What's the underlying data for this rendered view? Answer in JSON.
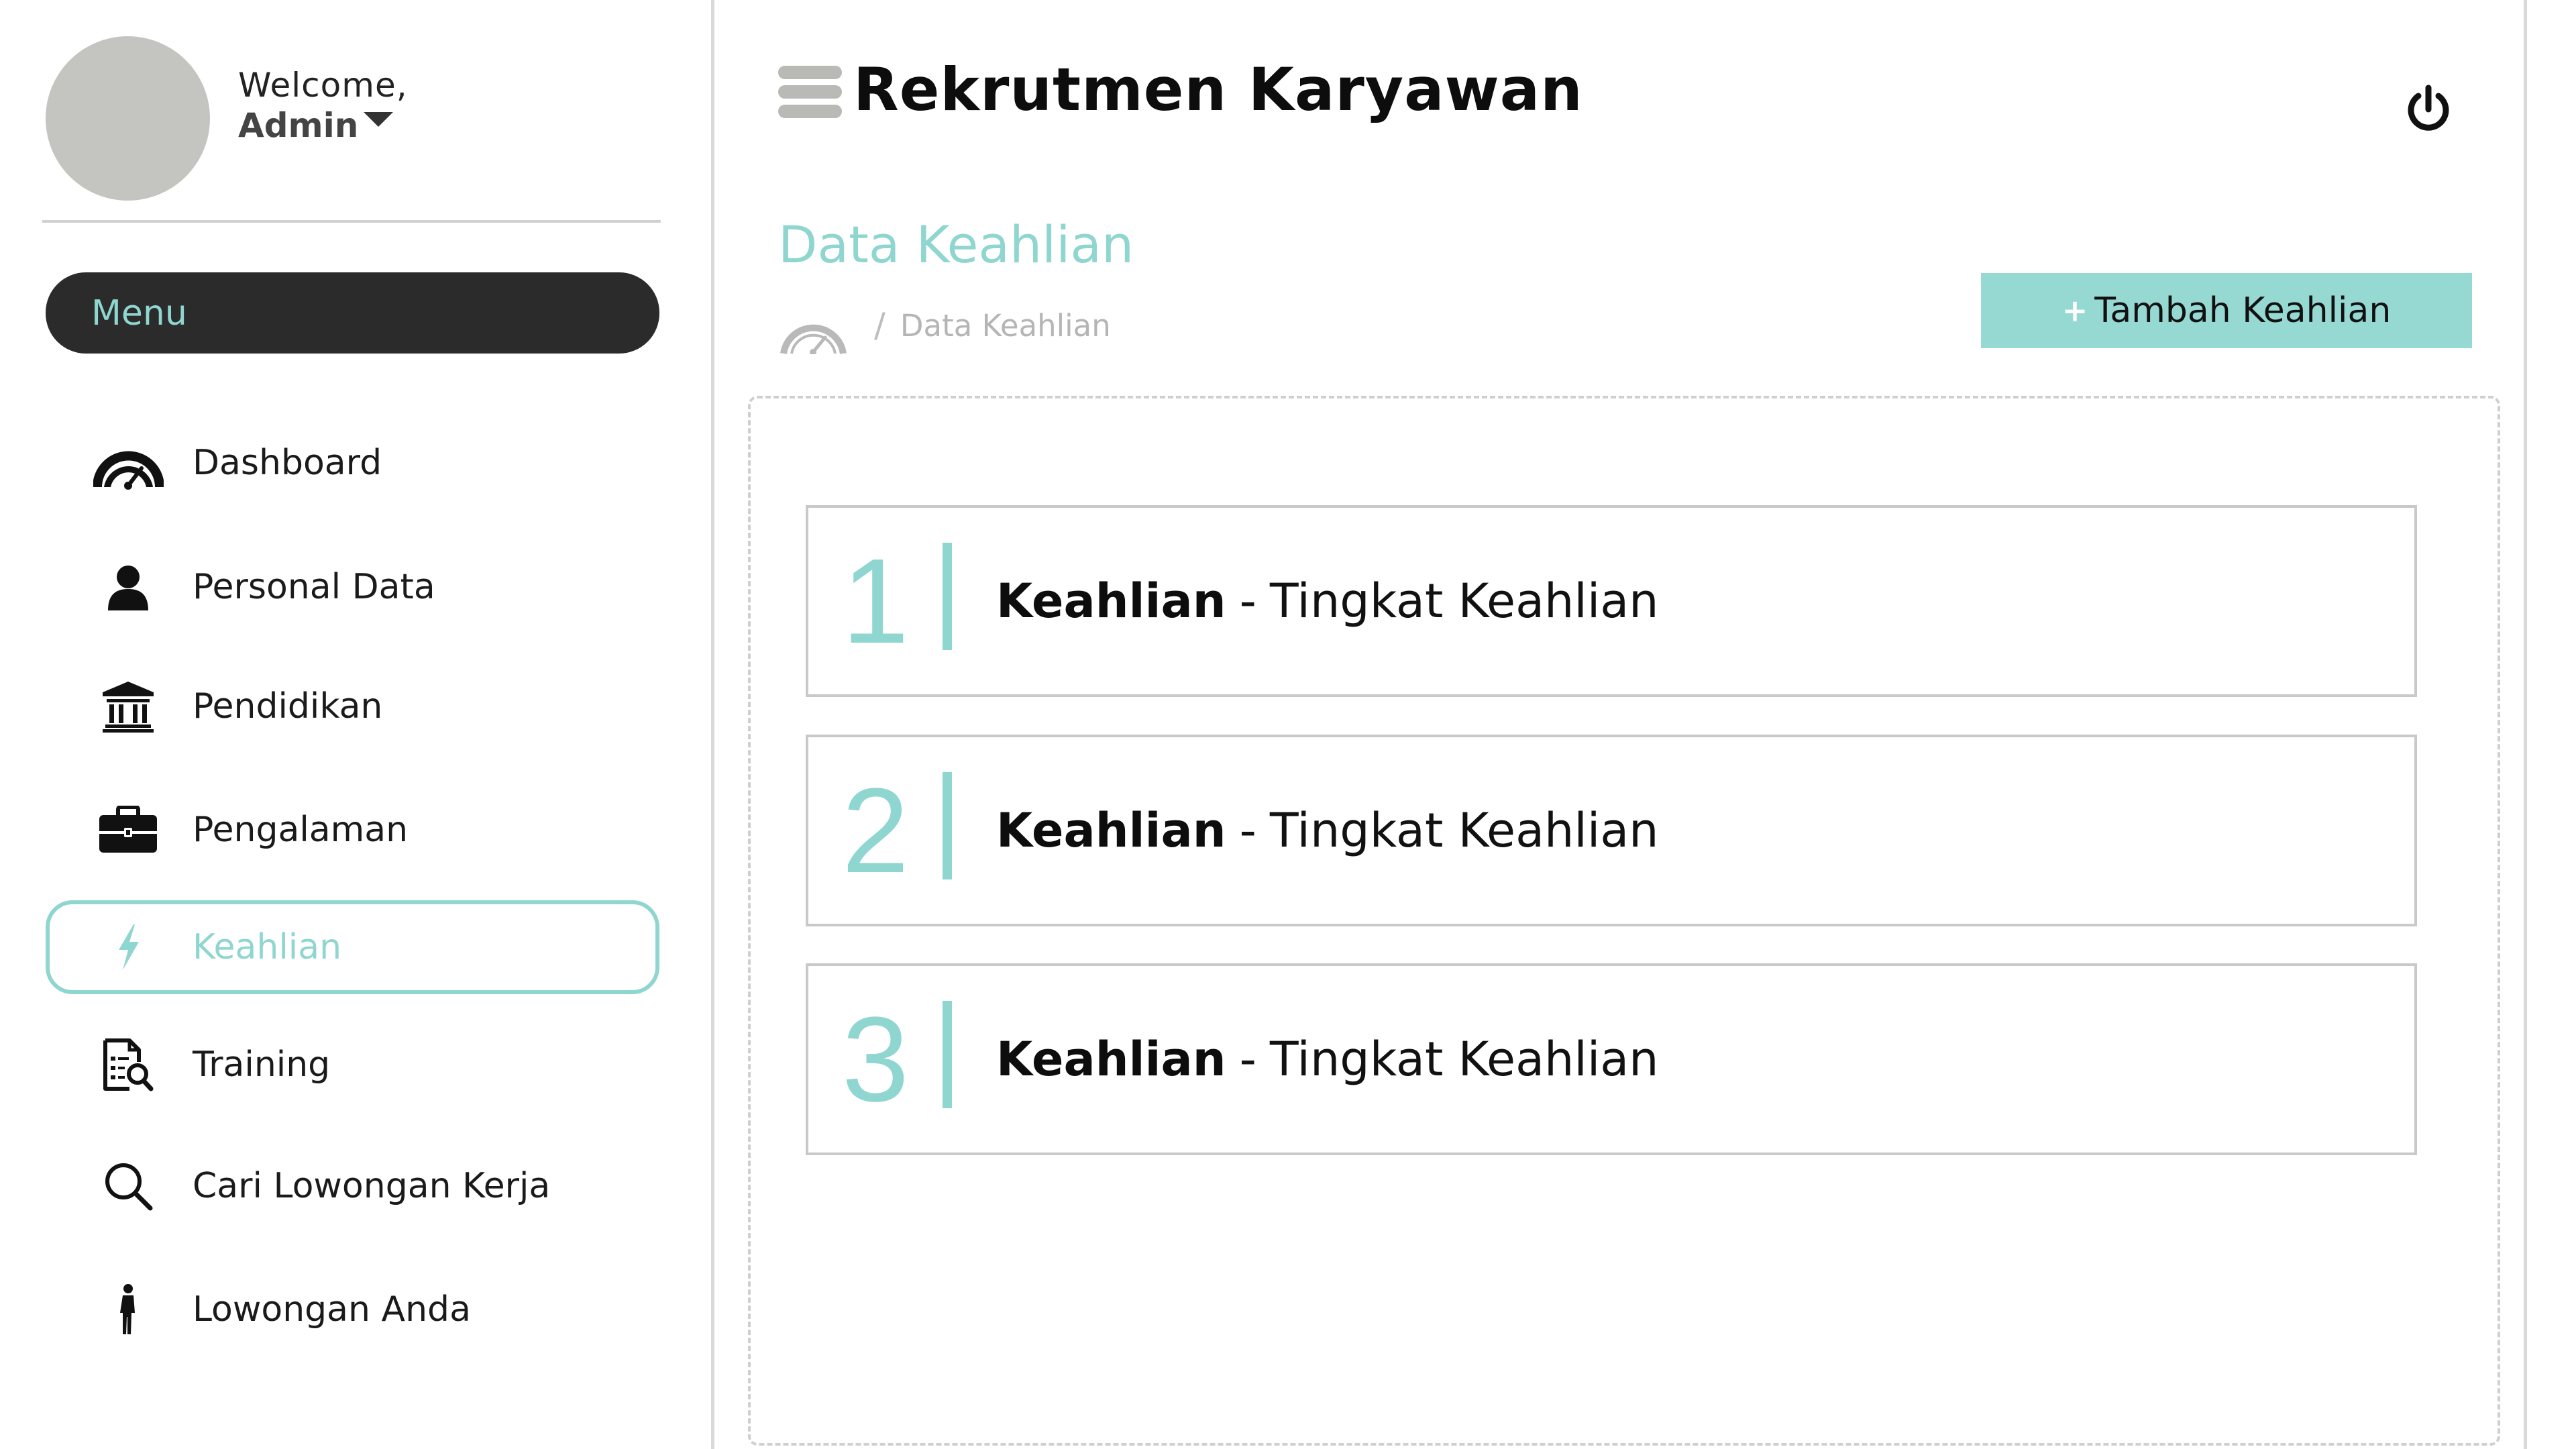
{
  "profile": {
    "welcome": "Welcome,",
    "name": "Admin"
  },
  "sidebar": {
    "menu_label": "Menu",
    "items": [
      {
        "label": "Dashboard",
        "icon": "dashboard-gauge-icon",
        "active": false
      },
      {
        "label": "Personal Data",
        "icon": "user-icon",
        "active": false
      },
      {
        "label": "Pendidikan",
        "icon": "institution-icon",
        "active": false
      },
      {
        "label": "Pengalaman",
        "icon": "briefcase-icon",
        "active": false
      },
      {
        "label": "Keahlian",
        "icon": "lightning-icon",
        "active": true
      },
      {
        "label": "Training",
        "icon": "document-search-icon",
        "active": false
      },
      {
        "label": "Cari Lowongan Kerja",
        "icon": "search-icon",
        "active": false
      },
      {
        "label": "Lowongan Anda",
        "icon": "person-walking-icon",
        "active": false
      }
    ]
  },
  "header": {
    "title": "Rekrutmen Karyawan"
  },
  "page": {
    "title": "Data Keahlian",
    "breadcrumb_separator": "/",
    "breadcrumb_current": "Data Keahlian",
    "add_button_plus": "+",
    "add_button_label": "Tambah Keahlian"
  },
  "skills": [
    {
      "number": "1",
      "name": "Keahlian",
      "separator": "-",
      "level": "Tingkat Keahlian"
    },
    {
      "number": "2",
      "name": "Keahlian",
      "separator": "-",
      "level": "Tingkat Keahlian"
    },
    {
      "number": "3",
      "name": "Keahlian",
      "separator": "-",
      "level": "Tingkat Keahlian"
    }
  ],
  "colors": {
    "accent": "#8fd6d0",
    "button": "#96d8d2",
    "menu_pill": "#2b2b2b",
    "avatar": "#c4c4c0"
  }
}
